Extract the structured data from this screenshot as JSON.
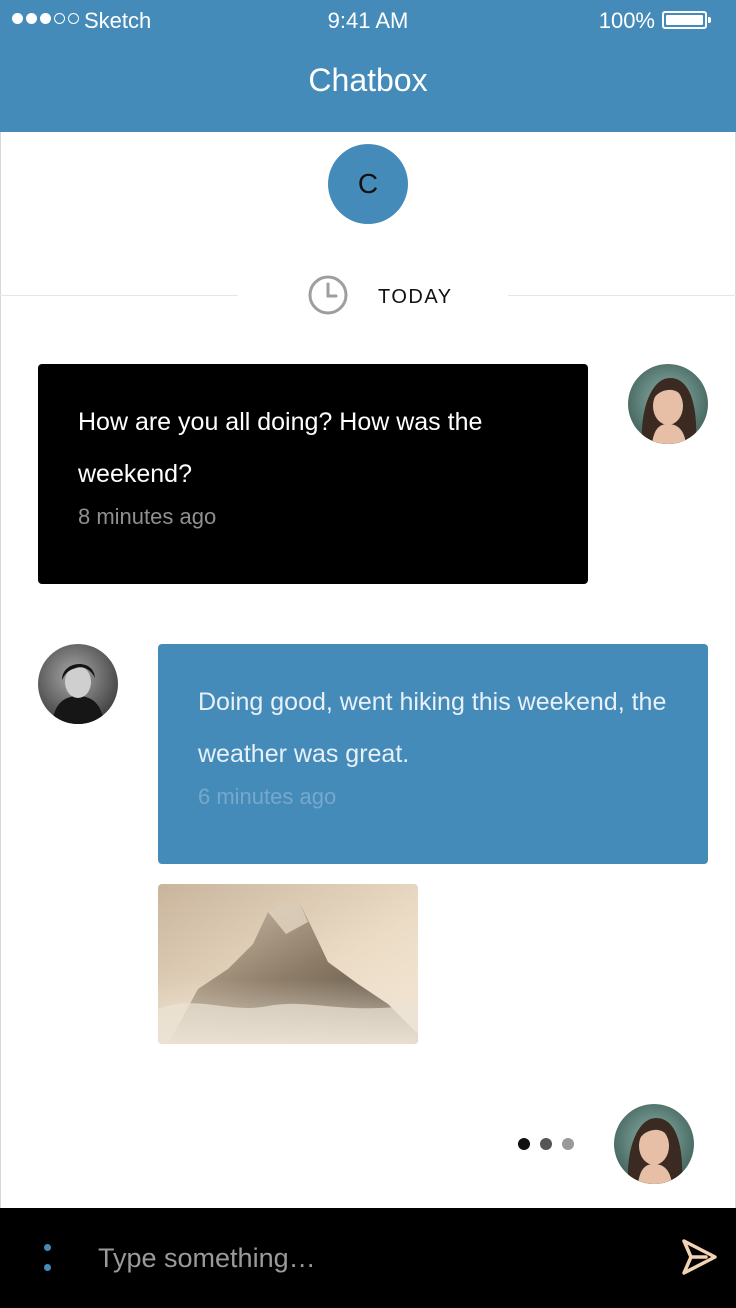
{
  "status_bar": {
    "carrier": "Sketch",
    "time": "9:41 AM",
    "battery": "100%"
  },
  "header": {
    "title": "Chatbox"
  },
  "contact": {
    "initial": "C"
  },
  "divider": {
    "label": "TODAY",
    "icon": "clock-icon"
  },
  "messages": [
    {
      "text": "How are you all doing? How was the weekend?",
      "time": "8 minutes ago",
      "side": "right"
    },
    {
      "text": "Doing good, went hiking this weekend, the weather was great.",
      "time": "6 minutes ago",
      "side": "left"
    }
  ],
  "composer": {
    "placeholder": "Type something…"
  },
  "colors": {
    "accent": "#458bba",
    "sent_bubble": "#000000",
    "composer_bg": "#000000",
    "send_icon": "#f2d4b4",
    "typing_dots": [
      "#111111",
      "#555555",
      "#999999"
    ]
  }
}
